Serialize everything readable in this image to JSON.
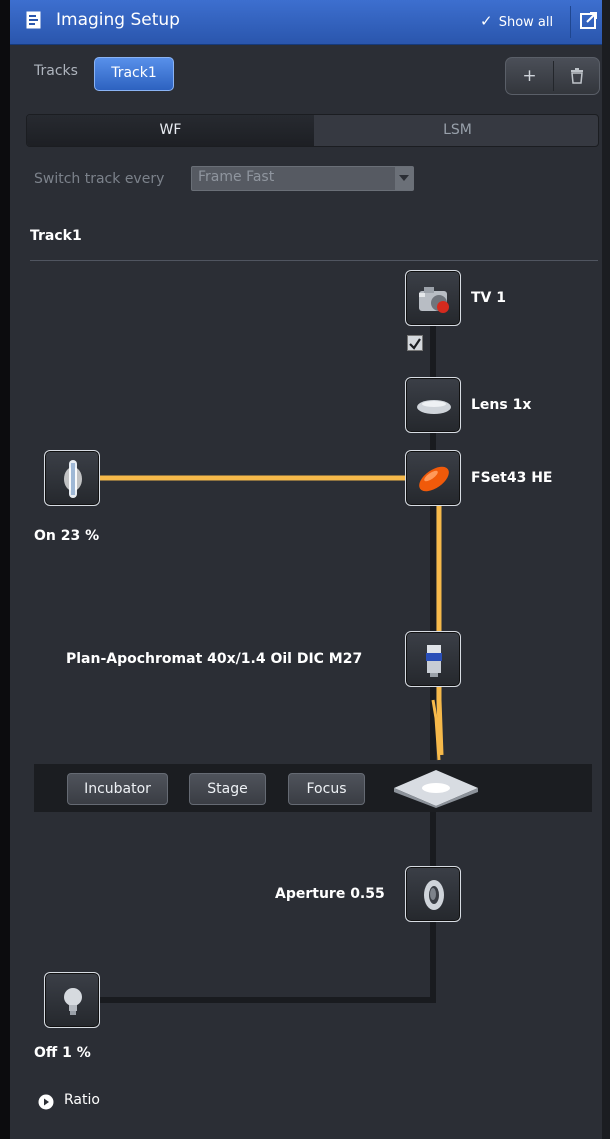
{
  "panel": {
    "title": "Imaging Setup",
    "show_all_label": "Show all"
  },
  "tracks": {
    "label": "Tracks",
    "active_track": "Track1"
  },
  "mode_tabs": [
    {
      "label": "WF",
      "selected": true
    },
    {
      "label": "LSM",
      "selected": false
    }
  ],
  "switch_track": {
    "label": "Switch track every",
    "value": "Frame Fast"
  },
  "track_section": {
    "title": "Track1"
  },
  "light_path": {
    "camera_label": "TV 1",
    "camera_checked": true,
    "lens_label": "Lens 1x",
    "filter_label": "FSet43 HE",
    "fluor_lamp_label": "On 23 %",
    "objective_label": "Plan-Apochromat 40x/1.4 Oil DIC M27",
    "aperture_label": "Aperture 0.55",
    "trans_lamp_label": "Off 1 %"
  },
  "stage_buttons": {
    "incubator": "Incubator",
    "stage": "Stage",
    "focus": "Focus"
  },
  "ratio": {
    "label": "Ratio"
  },
  "colors": {
    "title_bar": "#3a6bcc",
    "panel_bg": "#2b2e35",
    "beam": "#f6b94a",
    "track_button": "#3f76d6"
  },
  "icons": [
    "doc-edit-icon",
    "check-icon",
    "undock-icon",
    "plus-icon",
    "trash-icon",
    "camera-icon",
    "lens-icon",
    "filter-icon",
    "fluor-lamp-icon",
    "objective-icon",
    "stage-icon",
    "aperture-icon",
    "halogen-lamp-icon",
    "play-circle-icon",
    "dropdown-arrow-icon"
  ]
}
